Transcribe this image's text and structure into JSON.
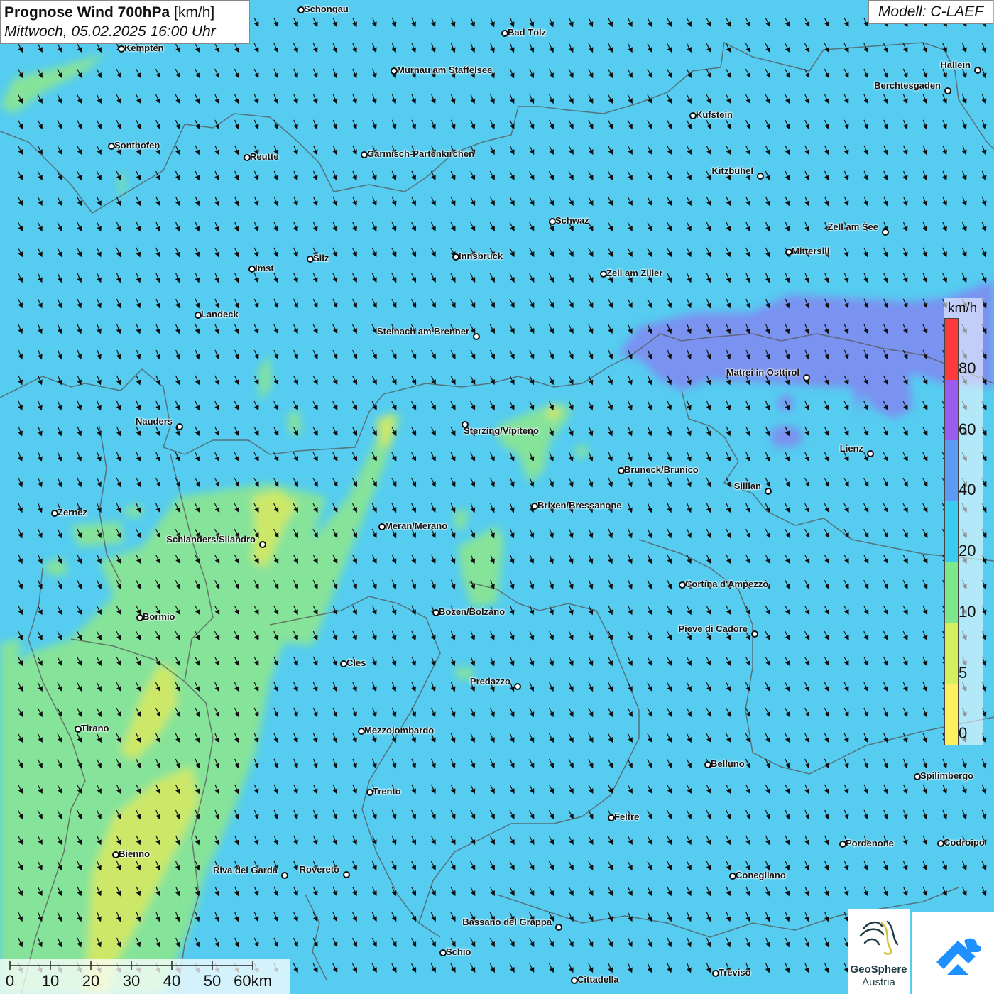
{
  "header": {
    "title_bold": "Prognose Wind 700hPa",
    "title_unit": "[km/h]",
    "datetime": "Mittwoch, 05.02.2025 16:00 Uhr",
    "model": "Modell: C-LAEF"
  },
  "legend": {
    "unit": "km/h",
    "ticks": [
      "80",
      "60",
      "40",
      "20",
      "10",
      "5",
      "0"
    ],
    "colors": [
      "#ff3a3a",
      "#9a5cf0",
      "#5b9bf5",
      "#3ccaf0",
      "#7de88a",
      "#d4f060",
      "#fff060"
    ]
  },
  "scale": {
    "labels": [
      "0",
      "10",
      "20",
      "30",
      "40",
      "50",
      "60km"
    ]
  },
  "cities": [
    {
      "name": "Schongau",
      "label": "right"
    },
    {
      "name": "Bad Tölz",
      "label": "right"
    },
    {
      "name": "Kempten",
      "label": "right"
    },
    {
      "name": "Murnau am Staffelsee",
      "label": "right"
    },
    {
      "name": "Hallein",
      "label": "left"
    },
    {
      "name": "Berchtesgaden",
      "label": "left"
    },
    {
      "name": "Kufstein",
      "label": "right"
    },
    {
      "name": "Sonthofen",
      "label": "right"
    },
    {
      "name": "Reutte",
      "label": "right"
    },
    {
      "name": "Garmisch-Partenkirchen",
      "label": "right"
    },
    {
      "name": "Kitzbühel",
      "label": "left"
    },
    {
      "name": "Schwaz",
      "label": "right"
    },
    {
      "name": "Zell am See",
      "label": "left"
    },
    {
      "name": "Innsbruck",
      "label": "right"
    },
    {
      "name": "Silz",
      "label": "right"
    },
    {
      "name": "Mittersill",
      "label": "right"
    },
    {
      "name": "Imst",
      "label": "right"
    },
    {
      "name": "Zell am Ziller",
      "label": "right"
    },
    {
      "name": "Landeck",
      "label": "right"
    },
    {
      "name": "Steinach am Brenner",
      "label": "left"
    },
    {
      "name": "Matrei in Osttirol",
      "label": "left"
    },
    {
      "name": "Nauders",
      "label": "left"
    },
    {
      "name": "Sterzing/Vipiteno",
      "label": "below"
    },
    {
      "name": "Lienz",
      "label": "left"
    },
    {
      "name": "Bruneck/Brunico",
      "label": "right"
    },
    {
      "name": "Sillian",
      "label": "left"
    },
    {
      "name": "Brixen/Bressanone",
      "label": "right"
    },
    {
      "name": "Zernez",
      "label": "right"
    },
    {
      "name": "Meran/Merano",
      "label": "right"
    },
    {
      "name": "Schlanders/Silandro",
      "label": "left"
    },
    {
      "name": "Cortina d'Ampezzo",
      "label": "right"
    },
    {
      "name": "Bozen/Bolzano",
      "label": "right"
    },
    {
      "name": "Bormio",
      "label": "right"
    },
    {
      "name": "Pieve di Cadore",
      "label": "left"
    },
    {
      "name": "Cles",
      "label": "right"
    },
    {
      "name": "Predazzo",
      "label": "left"
    },
    {
      "name": "Tirano",
      "label": "right"
    },
    {
      "name": "Mezzolombardo",
      "label": "right"
    },
    {
      "name": "Belluno",
      "label": "right"
    },
    {
      "name": "Spilimbergo",
      "label": "right"
    },
    {
      "name": "Trento",
      "label": "right"
    },
    {
      "name": "Feltre",
      "label": "right"
    },
    {
      "name": "Pordenone",
      "label": "right"
    },
    {
      "name": "Codroipo",
      "label": "right"
    },
    {
      "name": "Bienno",
      "label": "right"
    },
    {
      "name": "Riva del Garda",
      "label": "left"
    },
    {
      "name": "Rovereto",
      "label": "left"
    },
    {
      "name": "Conegliano",
      "label": "right"
    },
    {
      "name": "Bassano del Grappa",
      "label": "left"
    },
    {
      "name": "Schio",
      "label": "right"
    },
    {
      "name": "Treviso",
      "label": "right"
    },
    {
      "name": "Cittadella",
      "label": "right"
    }
  ],
  "logos": {
    "geosphere_name": "GeoSphere",
    "geosphere_sub": "Austria"
  }
}
